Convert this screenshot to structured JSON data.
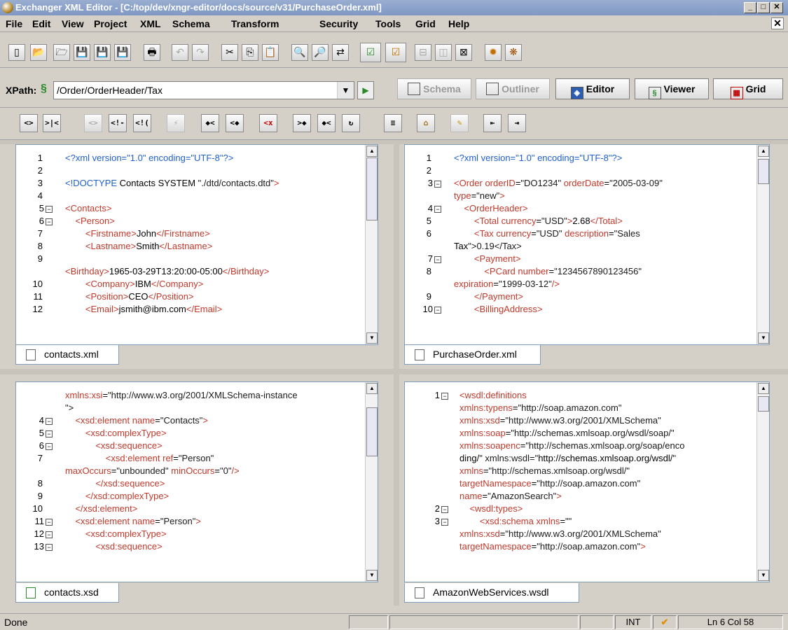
{
  "window": {
    "title": "Exchanger XML Editor - [C:/top/dev/xngr-editor/docs/source/v31/PurchaseOrder.xml]",
    "controls": [
      "_",
      "□",
      "✕"
    ]
  },
  "menu": {
    "items": [
      "File",
      "Edit",
      "View",
      "Project",
      "XML",
      "Schema",
      "Transform",
      "Security",
      "Tools",
      "Grid",
      "Help"
    ],
    "close": "✕"
  },
  "toolbar": {
    "icons": [
      "new-icon",
      "open-icon",
      "open-remote-icon",
      "save-icon",
      "save-as-icon",
      "save-all-icon",
      "print-icon",
      "undo-icon",
      "redo-icon",
      "cut-icon",
      "copy-icon",
      "paste-icon",
      "find-icon",
      "find-next-icon",
      "replace-icon",
      "validate-icon",
      "well-formed-icon",
      "split-horizontal-icon",
      "split-vertical-icon",
      "unsplit-icon",
      "settings-icon",
      "plugin-icon"
    ]
  },
  "xpath": {
    "label": "XPath:",
    "value": "/Order/OrderHeader/Tax"
  },
  "views": {
    "schema": "Schema",
    "outliner": "Outliner",
    "editor": "Editor",
    "viewer": "Viewer",
    "grid": "Grid"
  },
  "edit_toolbar": {
    "buttons": [
      "<>",
      ">|<",
      "<>",
      "<!-",
      "<!(",
      "⚡",
      "◆<",
      "<◆",
      "<x",
      ">◆",
      "◆<",
      "↻",
      "≡",
      "⌂",
      "✎",
      "⇤",
      "⇥"
    ]
  },
  "panes": {
    "top_left": {
      "tab": "contacts.xml",
      "lines": [
        {
          "n": "1",
          "fold": false
        },
        {
          "n": "2",
          "fold": false
        },
        {
          "n": "3",
          "fold": false
        },
        {
          "n": "4",
          "fold": false
        },
        {
          "n": "5",
          "fold": true
        },
        {
          "n": "6",
          "fold": true
        },
        {
          "n": "7",
          "fold": false
        },
        {
          "n": "8",
          "fold": false
        },
        {
          "n": "9",
          "fold": false
        },
        {
          "n": "",
          "fold": false
        },
        {
          "n": "10",
          "fold": false
        },
        {
          "n": "11",
          "fold": false
        },
        {
          "n": "12",
          "fold": false
        }
      ],
      "code": [
        "<?xml version=\"1.0\" encoding=\"UTF-8\"?>",
        "",
        "<!DOCTYPE Contacts SYSTEM \"./dtd/contacts.dtd\">",
        "",
        "<Contacts>",
        "    <Person>",
        "        <Firstname>John</Firstname>",
        "        <Lastname>Smith</Lastname>",
        "",
        "<Birthday>1965-03-29T13:20:00-05:00</Birthday>",
        "        <Company>IBM</Company>",
        "        <Position>CEO</Position>",
        "        <Email>jsmith@ibm.com</Email>"
      ]
    },
    "top_right": {
      "tab": "PurchaseOrder.xml",
      "gutter": [
        "1",
        "2",
        "3",
        "",
        "4",
        "5",
        "6",
        "",
        "7",
        "8",
        "",
        "9",
        "10"
      ],
      "code": [
        "<?xml version=\"1.0\" encoding=\"UTF-8\"?>",
        "",
        "<Order orderID=\"DO1234\" orderDate=\"2005-03-09\"",
        "type=\"new\">",
        "    <OrderHeader>",
        "        <Total currency=\"USD\">2.68</Total>",
        "        <Tax currency=\"USD\" description=\"Sales",
        "Tax\">0.19</Tax>",
        "        <Payment>",
        "            <PCard number=\"1234567890123456\"",
        "expiration=\"1999-03-12\"/>",
        "        </Payment>",
        "        <BillingAddress>"
      ]
    },
    "bottom_left": {
      "tab": "contacts.xsd",
      "gutter": [
        "",
        "",
        "4",
        "5",
        "6",
        "7",
        "",
        "8",
        "9",
        "10",
        "11",
        "12",
        "13"
      ],
      "code": [
        "xmlns:xsi=\"http://www.w3.org/2001/XMLSchema-instance",
        "\">",
        "    <xsd:element name=\"Contacts\">",
        "        <xsd:complexType>",
        "            <xsd:sequence>",
        "                <xsd:element ref=\"Person\"",
        "maxOccurs=\"unbounded\" minOccurs=\"0\"/>",
        "            </xsd:sequence>",
        "        </xsd:complexType>",
        "    </xsd:element>",
        "    <xsd:element name=\"Person\">",
        "        <xsd:complexType>",
        "            <xsd:sequence>"
      ]
    },
    "bottom_right": {
      "tab": "AmazonWebServices.wsdl",
      "gutter": [
        "1",
        "",
        "",
        "",
        "",
        "",
        "",
        "",
        "",
        "2",
        "3",
        "",
        ""
      ],
      "code": [
        "<wsdl:definitions",
        "xmlns:typens=\"http://soap.amazon.com\"",
        "xmlns:xsd=\"http://www.w3.org/2001/XMLSchema\"",
        "xmlns:soap=\"http://schemas.xmlsoap.org/wsdl/soap/\"",
        "xmlns:soapenc=\"http://schemas.xmlsoap.org/soap/enco",
        "ding/\" xmlns:wsdl=\"http://schemas.xmlsoap.org/wsdl/\"",
        "xmlns=\"http://schemas.xmlsoap.org/wsdl/\"",
        "targetNamespace=\"http://soap.amazon.com\"",
        "name=\"AmazonSearch\">",
        "    <wsdl:types>",
        "        <xsd:schema xmlns=\"\"",
        "xmlns:xsd=\"http://www.w3.org/2001/XMLSchema\"",
        "targetNamespace=\"http://soap.amazon.com\">"
      ]
    }
  },
  "status": {
    "message": "Done",
    "mode": "INT",
    "valid": "✔",
    "position": "Ln 6 Col 58"
  },
  "colors": {
    "tag": "#c0392b",
    "pi": "#1f5fd0",
    "text": "#1a1a1a",
    "valid": "#e09000"
  }
}
